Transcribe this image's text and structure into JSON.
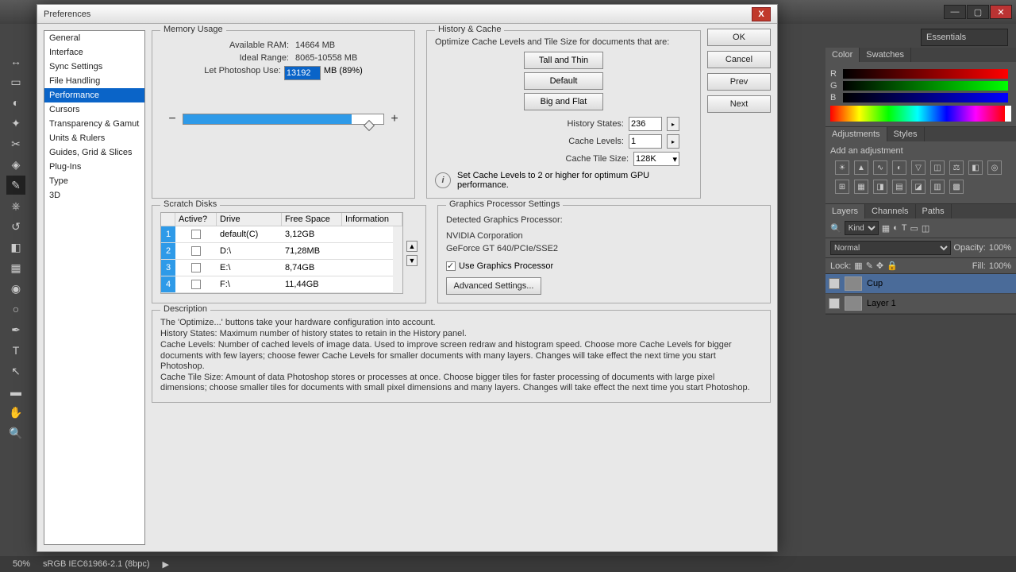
{
  "window": {
    "workspace": "Essentials"
  },
  "status": {
    "zoom": "50%",
    "profile": "sRGB IEC61966-2.1 (8bpc)"
  },
  "dialog": {
    "title": "Preferences",
    "sidebar": [
      "General",
      "Interface",
      "Sync Settings",
      "File Handling",
      "Performance",
      "Cursors",
      "Transparency & Gamut",
      "Units & Rulers",
      "Guides, Grid & Slices",
      "Plug-Ins",
      "Type",
      "3D"
    ],
    "selected_index": 4,
    "buttons": {
      "ok": "OK",
      "cancel": "Cancel",
      "prev": "Prev",
      "next": "Next"
    },
    "memory": {
      "legend": "Memory Usage",
      "available_label": "Available RAM:",
      "available_value": "14664 MB",
      "ideal_label": "Ideal Range:",
      "ideal_value": "8065-10558 MB",
      "let_label": "Let Photoshop Use:",
      "let_value": "13192",
      "let_suffix": "MB (89%)"
    },
    "history": {
      "legend": "History & Cache",
      "optimize_text": "Optimize Cache Levels and Tile Size for documents that are:",
      "btn_tall": "Tall and Thin",
      "btn_default": "Default",
      "btn_big": "Big and Flat",
      "states_label": "History States:",
      "states_value": "236",
      "levels_label": "Cache Levels:",
      "levels_value": "1",
      "tile_label": "Cache Tile Size:",
      "tile_value": "128K",
      "note": "Set Cache Levels to 2 or higher for optimum GPU performance."
    },
    "scratch": {
      "legend": "Scratch Disks",
      "headers": {
        "active": "Active?",
        "drive": "Drive",
        "free": "Free Space",
        "info": "Information"
      },
      "rows": [
        {
          "idx": "1",
          "drive": "default(C)",
          "free": "3,12GB"
        },
        {
          "idx": "2",
          "drive": "D:\\",
          "free": "71,28MB"
        },
        {
          "idx": "3",
          "drive": "E:\\",
          "free": "8,74GB"
        },
        {
          "idx": "4",
          "drive": "F:\\",
          "free": "11,44GB"
        }
      ]
    },
    "gpu": {
      "legend": "Graphics Processor Settings",
      "detected_label": "Detected Graphics Processor:",
      "vendor": "NVIDIA Corporation",
      "model": "GeForce GT 640/PCIe/SSE2",
      "use_label": "Use Graphics Processor",
      "advanced": "Advanced Settings..."
    },
    "desc": {
      "legend": "Description",
      "p1": "The 'Optimize...' buttons take your hardware configuration into account.",
      "p2": "History States: Maximum number of history states to retain in the History panel.",
      "p3": "Cache Levels: Number of cached levels of image data.  Used to improve screen redraw and histogram speed.  Choose more Cache Levels for bigger documents with few layers; choose fewer Cache Levels for smaller documents with many layers. Changes will take effect the next time you start Photoshop.",
      "p4": "Cache Tile Size: Amount of data Photoshop stores or processes at once. Choose bigger tiles for faster processing of documents with large pixel dimensions; choose smaller tiles for documents with small pixel dimensions and many layers. Changes will take effect the next time you start Photoshop."
    }
  },
  "color_panel": {
    "tab1": "Color",
    "tab2": "Swatches",
    "r": "R",
    "g": "G",
    "b": "B"
  },
  "adjustments_panel": {
    "tab1": "Adjustments",
    "tab2": "Styles",
    "hint": "Add an adjustment"
  },
  "layers_panel": {
    "tabs": [
      "Layers",
      "Channels",
      "Paths"
    ],
    "kind": "Kind",
    "blend": "Normal",
    "opacity_label": "Opacity:",
    "opacity": "100%",
    "lock_label": "Lock:",
    "fill_label": "Fill:",
    "fill": "100%",
    "items": [
      {
        "name": "Cup"
      },
      {
        "name": "Layer 1"
      }
    ]
  }
}
